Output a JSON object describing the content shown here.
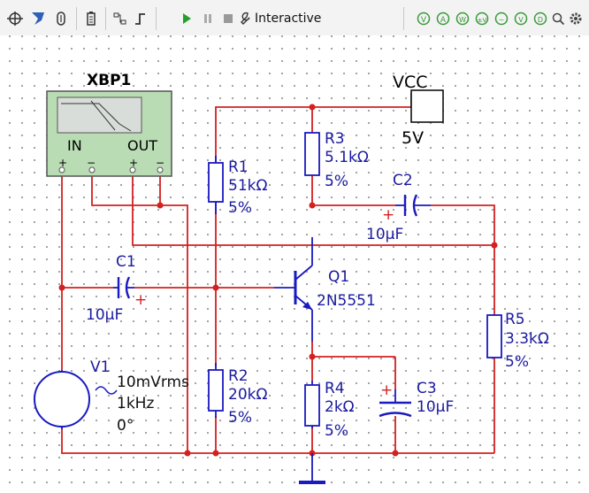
{
  "toolbar": {
    "mode_label": "Interactive",
    "left_icons": [
      "analysis-icon",
      "probe-icon",
      "clip-icon",
      "battery-icon",
      "grapher-icon",
      "pulse-icon"
    ],
    "run_controls": [
      "play-icon",
      "pause-icon",
      "stop-icon"
    ],
    "right_icons": [
      "probe-v-icon",
      "probe-a-icon",
      "probe-w-icon",
      "probe-dv-icon",
      "probe-vac-icon",
      "probe-f-icon",
      "probe-digital-icon",
      "search-icon",
      "settings-icon"
    ]
  },
  "schematic": {
    "xbp1": {
      "name": "XBP1",
      "in_label": "IN",
      "out_label": "OUT",
      "plus": "+",
      "minus": "−",
      "colors": {
        "body": "#b9dcb4"
      }
    },
    "vcc": {
      "label": "VCC",
      "value": "5V"
    },
    "r1": {
      "ref": "R1",
      "value": "51kΩ",
      "tol": "5%"
    },
    "r2": {
      "ref": "R2",
      "value": "20kΩ",
      "tol": "5%"
    },
    "r3": {
      "ref": "R3",
      "value": "5.1kΩ",
      "tol": "5%"
    },
    "r4": {
      "ref": "R4",
      "value": "2kΩ",
      "tol": "5%"
    },
    "r5": {
      "ref": "R5",
      "value": "3.3kΩ",
      "tol": "5%"
    },
    "c1": {
      "ref": "C1",
      "value": "10µF",
      "plus": "+"
    },
    "c2": {
      "ref": "C2",
      "value": "10µF",
      "plus": "+"
    },
    "c3": {
      "ref": "C3",
      "value": "10µF",
      "plus": "+"
    },
    "q1": {
      "ref": "Q1",
      "model": "2N5551"
    },
    "v1": {
      "ref": "V1",
      "amplitude": "10mVrms",
      "freq": "1kHz",
      "phase": "0°"
    },
    "colors": {
      "wire": "#d42020",
      "component": "#1a1ac0",
      "label": "#1a1aa0",
      "junction": "#d42020"
    }
  }
}
